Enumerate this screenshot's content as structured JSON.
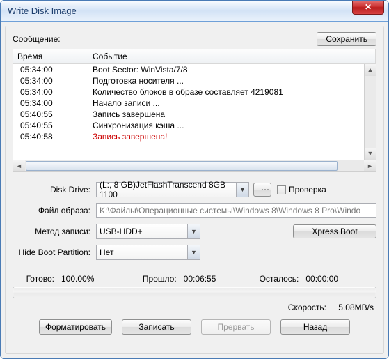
{
  "window": {
    "title": "Write Disk Image"
  },
  "labels": {
    "message": "Сообщение:",
    "save": "Сохранить",
    "col_time": "Время",
    "col_event": "Событие",
    "disk_drive": "Disk Drive:",
    "check": "Проверка",
    "image_file": "Файл образа:",
    "write_method": "Метод записи:",
    "xpress_boot": "Xpress Boot",
    "hide_boot": "Hide Boot Partition:",
    "ready": "Готово:",
    "elapsed": "Прошло:",
    "remain": "Осталось:",
    "speed": "Скорость:",
    "format": "Форматировать",
    "write": "Записать",
    "abort": "Прервать",
    "back": "Назад"
  },
  "log": [
    {
      "time": "05:34:00",
      "event": "Boot Sector: WinVista/7/8"
    },
    {
      "time": "05:34:00",
      "event": "Подготовка носителя ..."
    },
    {
      "time": "05:34:00",
      "event": "Количество блоков в образе составляет 4219081"
    },
    {
      "time": "05:34:00",
      "event": "Начало записи ..."
    },
    {
      "time": "05:40:55",
      "event": "Запись завершена"
    },
    {
      "time": "05:40:55",
      "event": "Синхронизация кэша ..."
    },
    {
      "time": "05:40:58",
      "event": "Запись завершена!",
      "highlight": true
    }
  ],
  "form": {
    "drive": "(L:, 8 GB)JetFlashTranscend 8GB  1100",
    "image": "K:\\Файлы\\Операционные системы\\Windows 8\\Windows 8 Pro\\Windo",
    "method": "USB-HDD+",
    "hide": "Нет"
  },
  "status": {
    "ready_pct": "100.00%",
    "elapsed_val": "00:06:55",
    "remain_val": "00:00:00",
    "speed_val": "5.08MB/s"
  }
}
